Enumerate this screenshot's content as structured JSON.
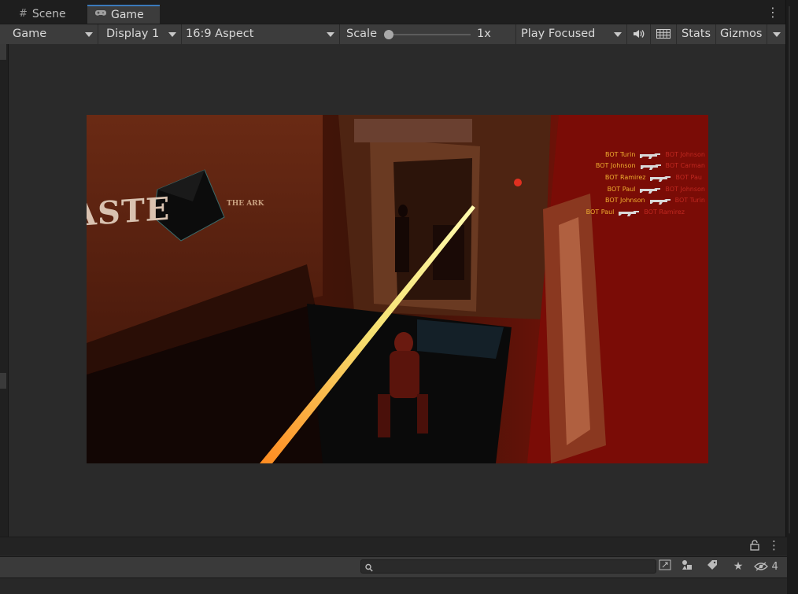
{
  "tabs": [
    {
      "label": "Scene",
      "icon": "grid-icon"
    },
    {
      "label": "Game",
      "icon": "gamepad-icon",
      "active": true
    }
  ],
  "toolbar": {
    "view_mode": "Game",
    "display": "Display 1",
    "aspect": "16:9 Aspect",
    "scale_label": "Scale",
    "scale_value": "1x",
    "scale_fraction": 0.0,
    "play_mode": "Play Focused",
    "stats_label": "Stats",
    "gizmos_label": "Gizmos"
  },
  "game": {
    "wall_logo": "ASTE",
    "wall_logo_sub": "THE ARK",
    "killfeed": [
      {
        "killer": "BOT Turin",
        "victim": "BOT Johnson"
      },
      {
        "killer": "BOT Johnson",
        "victim": "BOT Carman"
      },
      {
        "killer": "BOT Ramirez",
        "victim": "BOT Pau"
      },
      {
        "killer": "BOT Paul",
        "victim": "BOT Johnson"
      },
      {
        "killer": "BOT Johnson",
        "victim": "BOT Turin"
      },
      {
        "killer": "BOT Paul",
        "victim": "BOT Ramirez"
      }
    ]
  },
  "bottom": {
    "search_placeholder": "",
    "hidden_count": "4"
  },
  "colors": {
    "accent": "#3a79bb",
    "panel": "#3c3c3c",
    "background": "#2a2a2a",
    "kill_name": "#f0b030",
    "victim_name": "#c02820"
  }
}
